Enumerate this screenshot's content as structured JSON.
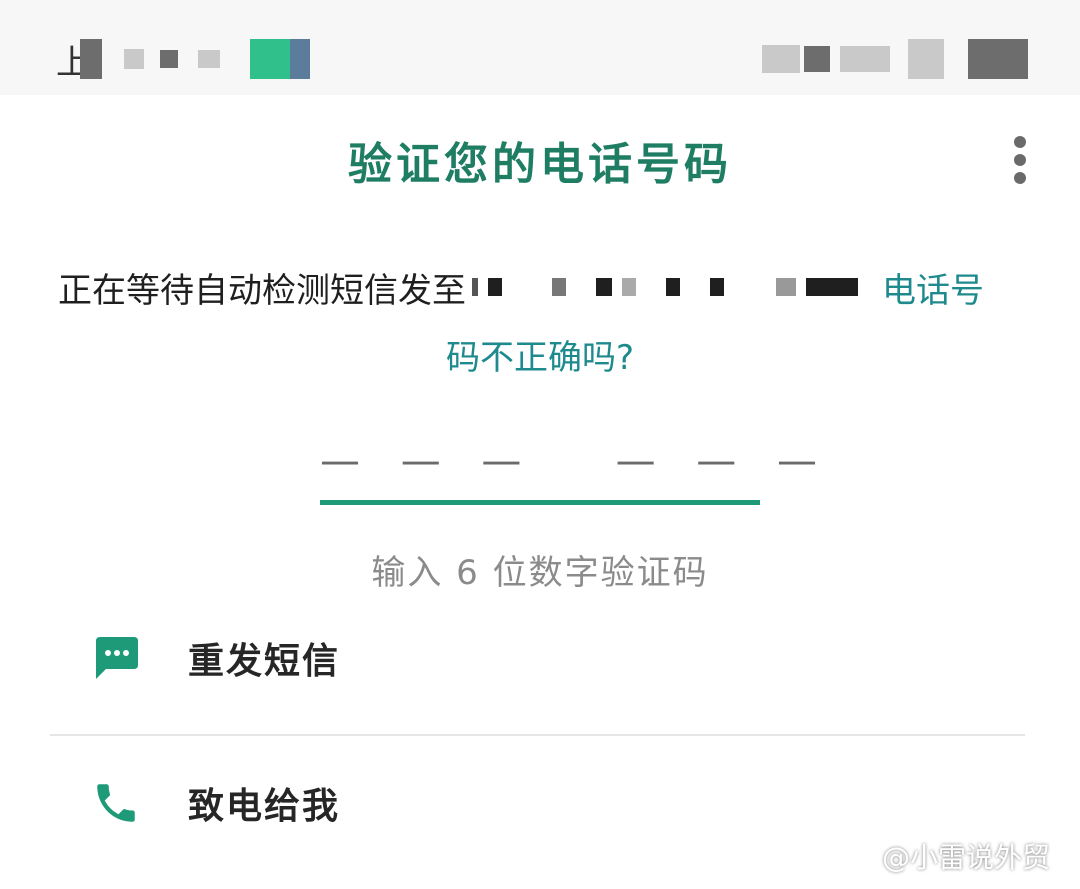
{
  "status_bar": {
    "time": "上"
  },
  "header": {
    "title": "验证您的电话号码"
  },
  "message": {
    "text": "正在等待自动检测短信发至",
    "link_part1": "电话号",
    "link_part2": "码不正确吗?"
  },
  "code_input": {
    "dashes": "— — —   — — —",
    "hint": "输入 6 位数字验证码"
  },
  "actions": [
    {
      "label": "重发短信",
      "icon": "message-icon"
    },
    {
      "label": "致电给我",
      "icon": "phone-icon"
    }
  ],
  "watermark": {
    "text": "@小雷说外贸"
  },
  "colors": {
    "accent": "#1e7d62",
    "link": "#1f8a8d",
    "input_line": "#1e9a78"
  }
}
